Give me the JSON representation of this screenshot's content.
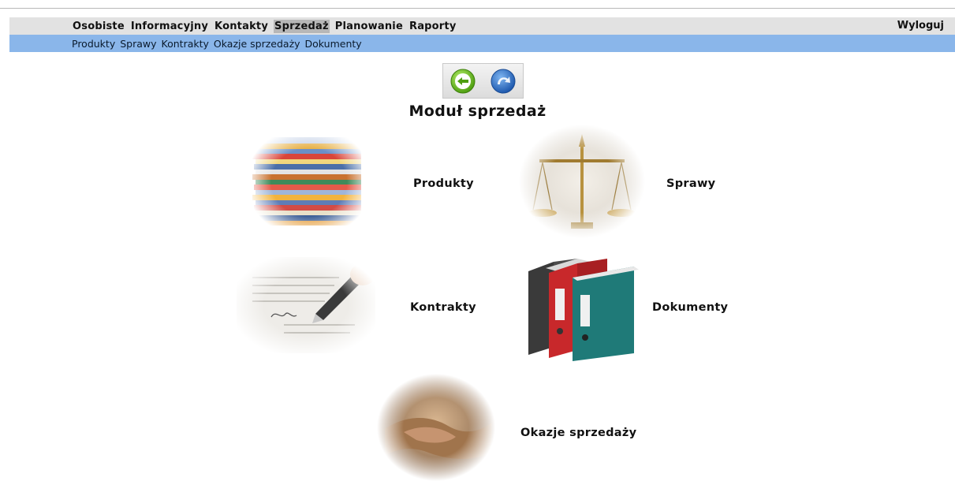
{
  "main_menu": {
    "items": [
      {
        "label": "Osobiste"
      },
      {
        "label": "Informacyjny"
      },
      {
        "label": "Kontakty"
      },
      {
        "label": "Sprzedaż",
        "active": true
      },
      {
        "label": "Planowanie"
      },
      {
        "label": "Raporty"
      }
    ],
    "logout_label": "Wyloguj"
  },
  "sub_menu": {
    "items": [
      {
        "label": "Produkty"
      },
      {
        "label": "Sprawy"
      },
      {
        "label": "Kontrakty"
      },
      {
        "label": "Okazje sprzedaży"
      },
      {
        "label": "Dokumenty"
      }
    ]
  },
  "nav_buttons": {
    "back_icon": "arrow-left-circle-icon",
    "refresh_icon": "refresh-icon"
  },
  "page": {
    "title": "Moduł sprzedaż"
  },
  "tiles": {
    "produkty": {
      "label": "Produkty",
      "icon": "stacked-books-image"
    },
    "sprawy": {
      "label": "Sprawy",
      "icon": "scales-of-justice-image"
    },
    "kontrakty": {
      "label": "Kontrakty",
      "icon": "pen-signing-document-image"
    },
    "dokumenty": {
      "label": "Dokumenty",
      "icon": "binders-image"
    },
    "okazje": {
      "label": "Okazje sprzedaży",
      "icon": "handshake-image"
    }
  },
  "colors": {
    "main_bar": "#e2e2e2",
    "sub_bar": "#8ab6ea",
    "active_item": "#b7b7b7",
    "back_button": "#6cc21e",
    "refresh_button": "#2a6fc9"
  }
}
